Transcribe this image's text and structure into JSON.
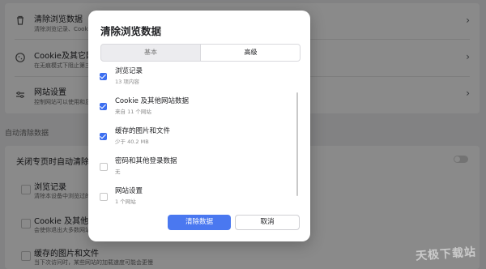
{
  "background": {
    "rows": [
      {
        "title": "清除浏览数据",
        "subtitle": "清除浏览记录、Cookie"
      },
      {
        "title": "Cookie及其它网站数",
        "subtitle": "在无痕模式下阻止第三"
      },
      {
        "title": "网站设置",
        "subtitle": "控制网站可以使用和显"
      }
    ],
    "section_title": "自动清除数据",
    "auto_clear_label": "关闭专页时自动清除浏览",
    "auto_items": [
      {
        "title": "浏览记录",
        "subtitle": "清除本设备中浏览过的"
      },
      {
        "title": "Cookie 及其他网站数",
        "subtitle": "会使你退出大多数网站"
      },
      {
        "title": "缓存的图片和文件",
        "subtitle": "当下次访问时，某些网站的加载速度可能会更慢"
      }
    ]
  },
  "dialog": {
    "title": "清除浏览数据",
    "tabs": [
      {
        "label": "基本",
        "active": false
      },
      {
        "label": "高级",
        "active": true
      }
    ],
    "items": [
      {
        "label": "浏览记录",
        "sub": "13 项内容",
        "checked": true
      },
      {
        "label": "Cookie 及其他网站数据",
        "sub": "来自 11 个网站",
        "checked": true
      },
      {
        "label": "缓存的图片和文件",
        "sub": "少于 40.2 MB",
        "checked": true
      },
      {
        "label": "密码和其他登录数据",
        "sub": "无",
        "checked": false
      },
      {
        "label": "网站设置",
        "sub": "1 个网站",
        "checked": false
      }
    ],
    "confirm_label": "清除数据",
    "cancel_label": "取消"
  },
  "watermark": "天极下载站",
  "colors": {
    "accent": "#4a78f0",
    "checkbox": "#3d6ff0"
  }
}
